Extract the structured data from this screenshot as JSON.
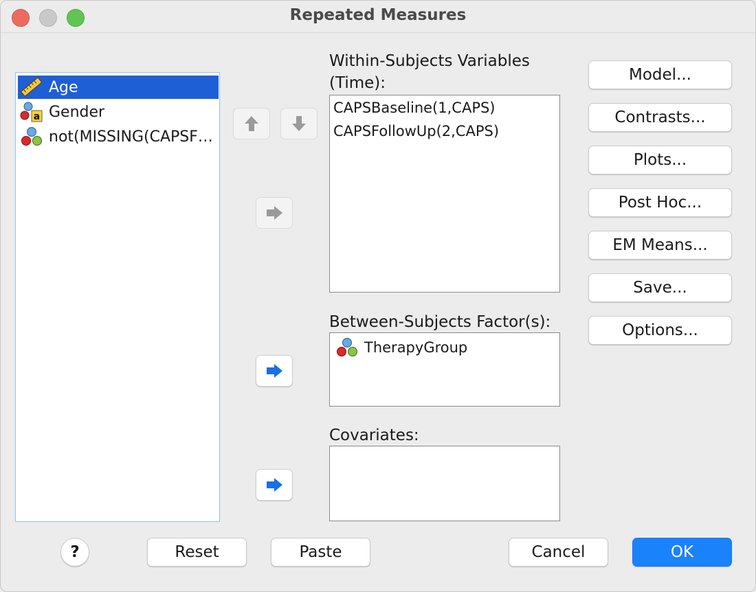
{
  "window": {
    "title": "Repeated Measures"
  },
  "variables": [
    {
      "label": "Age",
      "icon": "scale-ruler-icon",
      "selected": true
    },
    {
      "label": "Gender",
      "icon": "nominal-string-icon",
      "selected": false
    },
    {
      "label": "not(MISSING(CAPSF…",
      "icon": "nominal-icon",
      "selected": false
    }
  ],
  "within_subjects": {
    "label_line1": "Within-Subjects Variables",
    "label_line2": "(Time):",
    "items": [
      "CAPSBaseline(1,CAPS)",
      "CAPSFollowUp(2,CAPS)"
    ]
  },
  "between_subjects": {
    "label": "Between-Subjects Factor(s):",
    "items": [
      "TherapyGroup"
    ]
  },
  "covariates": {
    "label": "Covariates:",
    "items": []
  },
  "side_buttons": {
    "model": "Model...",
    "contrasts": "Contrasts...",
    "plots": "Plots...",
    "post_hoc": "Post Hoc...",
    "em_means": "EM Means...",
    "save": "Save...",
    "options": "Options..."
  },
  "footer": {
    "help": "?",
    "reset": "Reset",
    "paste": "Paste",
    "cancel": "Cancel",
    "ok": "OK"
  },
  "colors": {
    "selection": "#1f5fd6",
    "primary_button": "#1a82fb",
    "active_arrow": "#1a6fe6",
    "inactive_arrow": "#9a9a9a"
  }
}
